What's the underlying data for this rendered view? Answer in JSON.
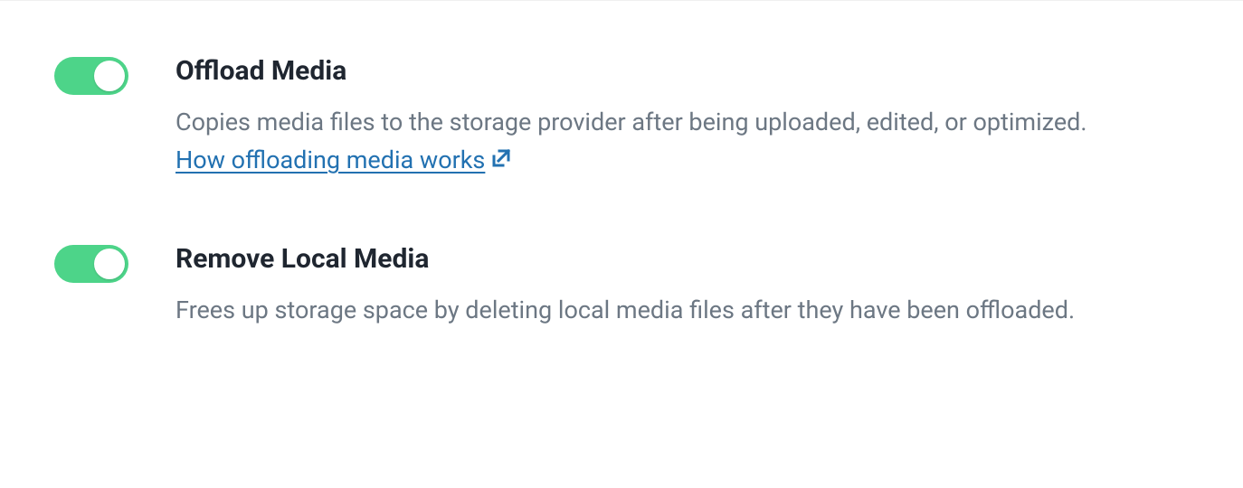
{
  "settings": [
    {
      "title": "Offload Media",
      "desc_before_link": "Copies media files to the storage provider after being uploaded, edited, or optimized. ",
      "link_text": "How offloading media works",
      "desc_after_link": ""
    },
    {
      "title": "Remove Local Media",
      "desc_before_link": "Frees up storage space by deleting local media files after they have been offloaded.",
      "link_text": "",
      "desc_after_link": ""
    }
  ]
}
